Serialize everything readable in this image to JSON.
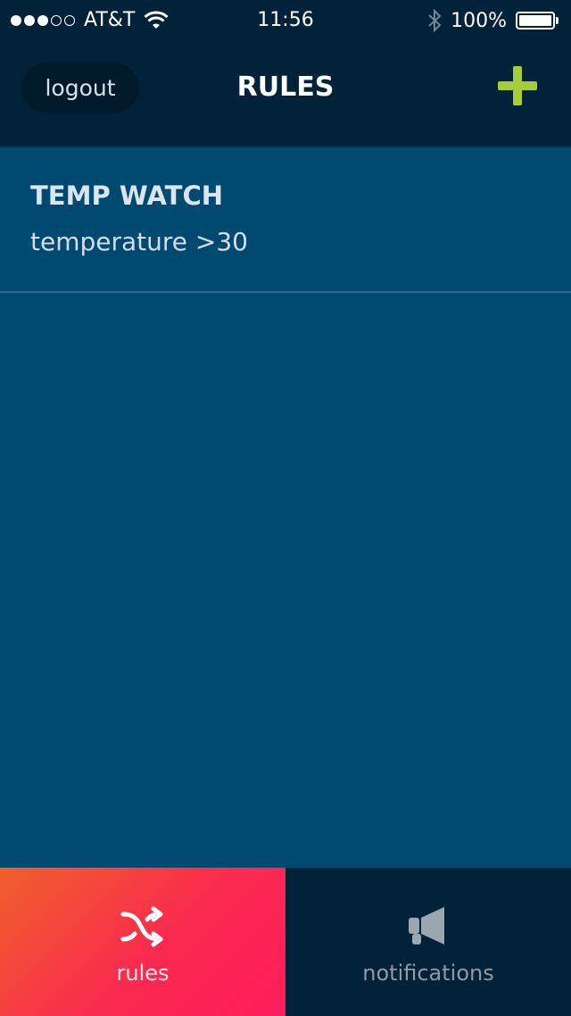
{
  "status_bar": {
    "carrier": "AT&T",
    "time": "11:56",
    "battery": "100%",
    "signal_bars_filled": 3,
    "signal_bars_total": 5
  },
  "header": {
    "logout_label": "logout",
    "title": "RULES",
    "add_icon": "plus-icon",
    "accent_color": "#a4cd39"
  },
  "rules": [
    {
      "name": "TEMP WATCH",
      "condition": "temperature >30"
    }
  ],
  "tab_bar": {
    "tabs": [
      {
        "label": "rules",
        "icon": "shuffle-icon",
        "active": true
      },
      {
        "label": "notifications",
        "icon": "megaphone-icon",
        "active": false
      }
    ]
  },
  "colors": {
    "background": "#004a71",
    "header_bg": "#012238",
    "active_tab_start": "#f0602c",
    "active_tab_end": "#ff1c5d"
  }
}
